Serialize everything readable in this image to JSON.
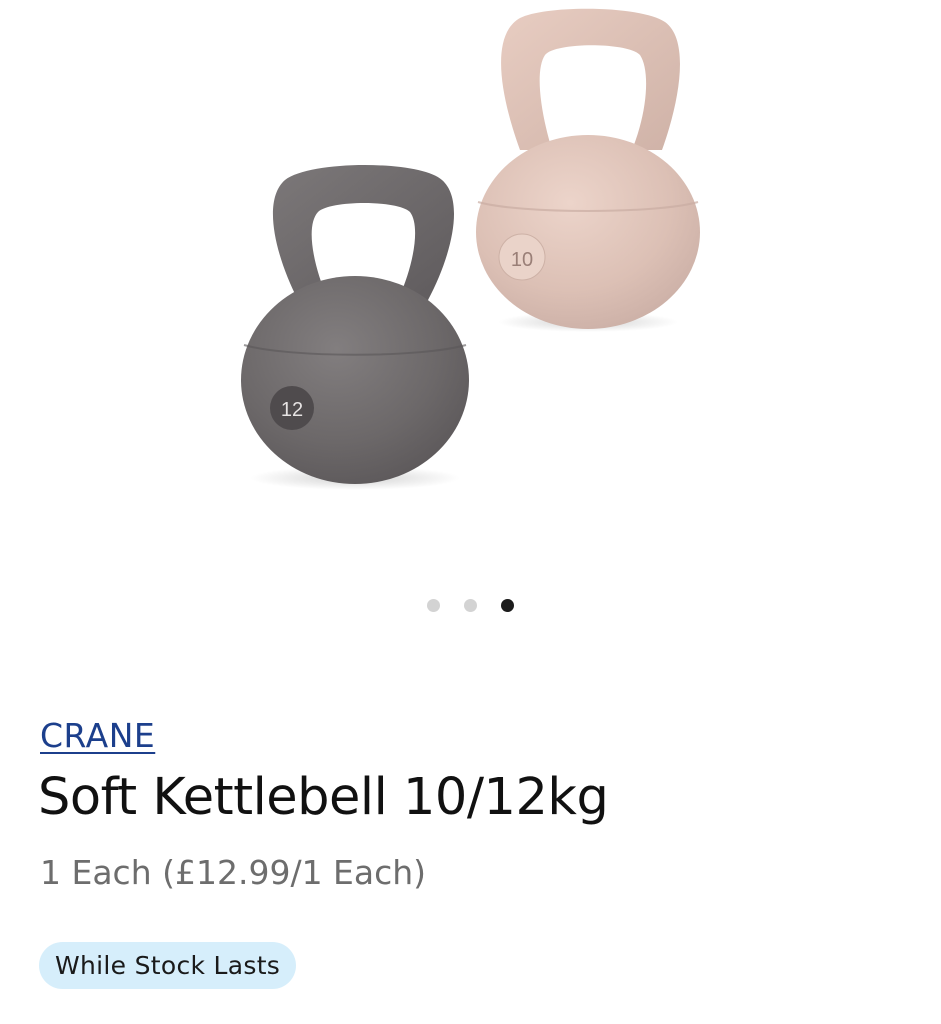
{
  "product": {
    "brand": "CRANE",
    "title": "Soft Kettlebell 10/12kg",
    "unit_price": "1 Each (£12.99/1 Each)",
    "badge": "While Stock Lasts"
  },
  "gallery": {
    "image_count": 3,
    "active_index": 2,
    "kettlebells": [
      {
        "weight_label": "12",
        "color": "#6e6a6b"
      },
      {
        "weight_label": "10",
        "color": "#dcc2b8"
      }
    ]
  },
  "colors": {
    "brand_link": "#1c3f8c",
    "badge_bg": "#d6eefb",
    "dot_inactive": "#d3d3d3",
    "dot_active": "#1c1c1c"
  }
}
